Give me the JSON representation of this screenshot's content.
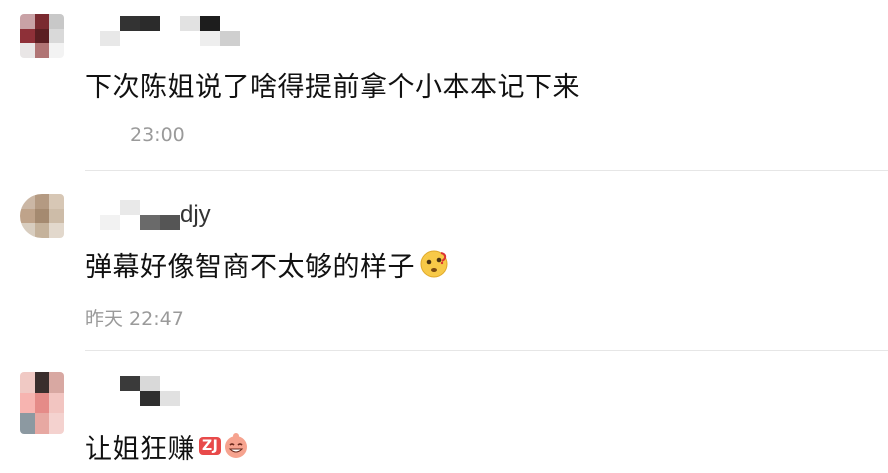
{
  "comments": [
    {
      "name": "",
      "text": "下次陈姐说了啥得提前拿个小本本记下来",
      "time": "23:00",
      "avatar_colors": [
        "#c9a2a6",
        "#7a2a30",
        "#c8c8c8",
        "#8e3038",
        "#5a1e22",
        "#d9d9d9",
        "#e9e6e6",
        "#b07474",
        "#f3f3f3"
      ]
    },
    {
      "name": "djy",
      "text": "弹幕好像智商不太够的样子",
      "emoji": "thinking-face-emoji",
      "time": "昨天 22:47",
      "avatar_colors": [
        "#cbb7a5",
        "#b49a82",
        "#d7c7b5",
        "#bfa38a",
        "#a58a70",
        "#cdbca8",
        "#d8cdbf",
        "#c5b29b",
        "#e2d8cc"
      ]
    },
    {
      "name": "",
      "text": "让姐狂赚",
      "emoji_badge": "ZJ",
      "time": "",
      "avatar_colors": [
        "#f0c9c4",
        "#3a2e2d",
        "#d8a8a2",
        "#f7b4b0",
        "#e58b88",
        "#f2c5c1",
        "#8c99a1",
        "#e7a8a2",
        "#f4d2cf"
      ]
    }
  ],
  "colors": {
    "text": "#111111",
    "time": "#9a9a9a",
    "divider": "#e6e6e6"
  }
}
